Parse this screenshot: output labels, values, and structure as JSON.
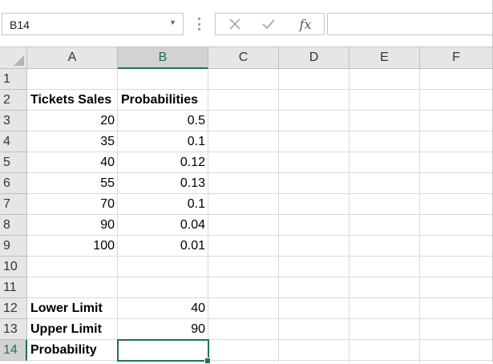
{
  "formula_bar": {
    "name_box": "B14",
    "formula": "",
    "icons": [
      "cancel-icon",
      "enter-icon",
      "fx-icon"
    ],
    "fx_label": "fx"
  },
  "columns": [
    "A",
    "B",
    "C",
    "D",
    "E",
    "F"
  ],
  "rows": [
    "1",
    "2",
    "3",
    "4",
    "5",
    "6",
    "7",
    "8",
    "9",
    "10",
    "11",
    "12",
    "13",
    "14"
  ],
  "selected_cell": "B14",
  "cells": {
    "A2": "Tickets Sales",
    "B2": "Probabilities",
    "A3": "20",
    "B3": "0.5",
    "A4": "35",
    "B4": "0.1",
    "A5": "40",
    "B5": "0.12",
    "A6": "55",
    "B6": "0.13",
    "A7": "70",
    "B7": "0.1",
    "A8": "90",
    "B8": "0.04",
    "A9": "100",
    "B9": "0.01",
    "A12": "Lower Limit",
    "B12": "40",
    "A13": "Upper Limit",
    "B13": "90",
    "A14": "Probability",
    "B14": ""
  },
  "colors": {
    "accent": "#217346",
    "header_bg": "#e6e6e6",
    "selected_header_bg": "#d2d2d2",
    "gridline": "#dadada"
  }
}
